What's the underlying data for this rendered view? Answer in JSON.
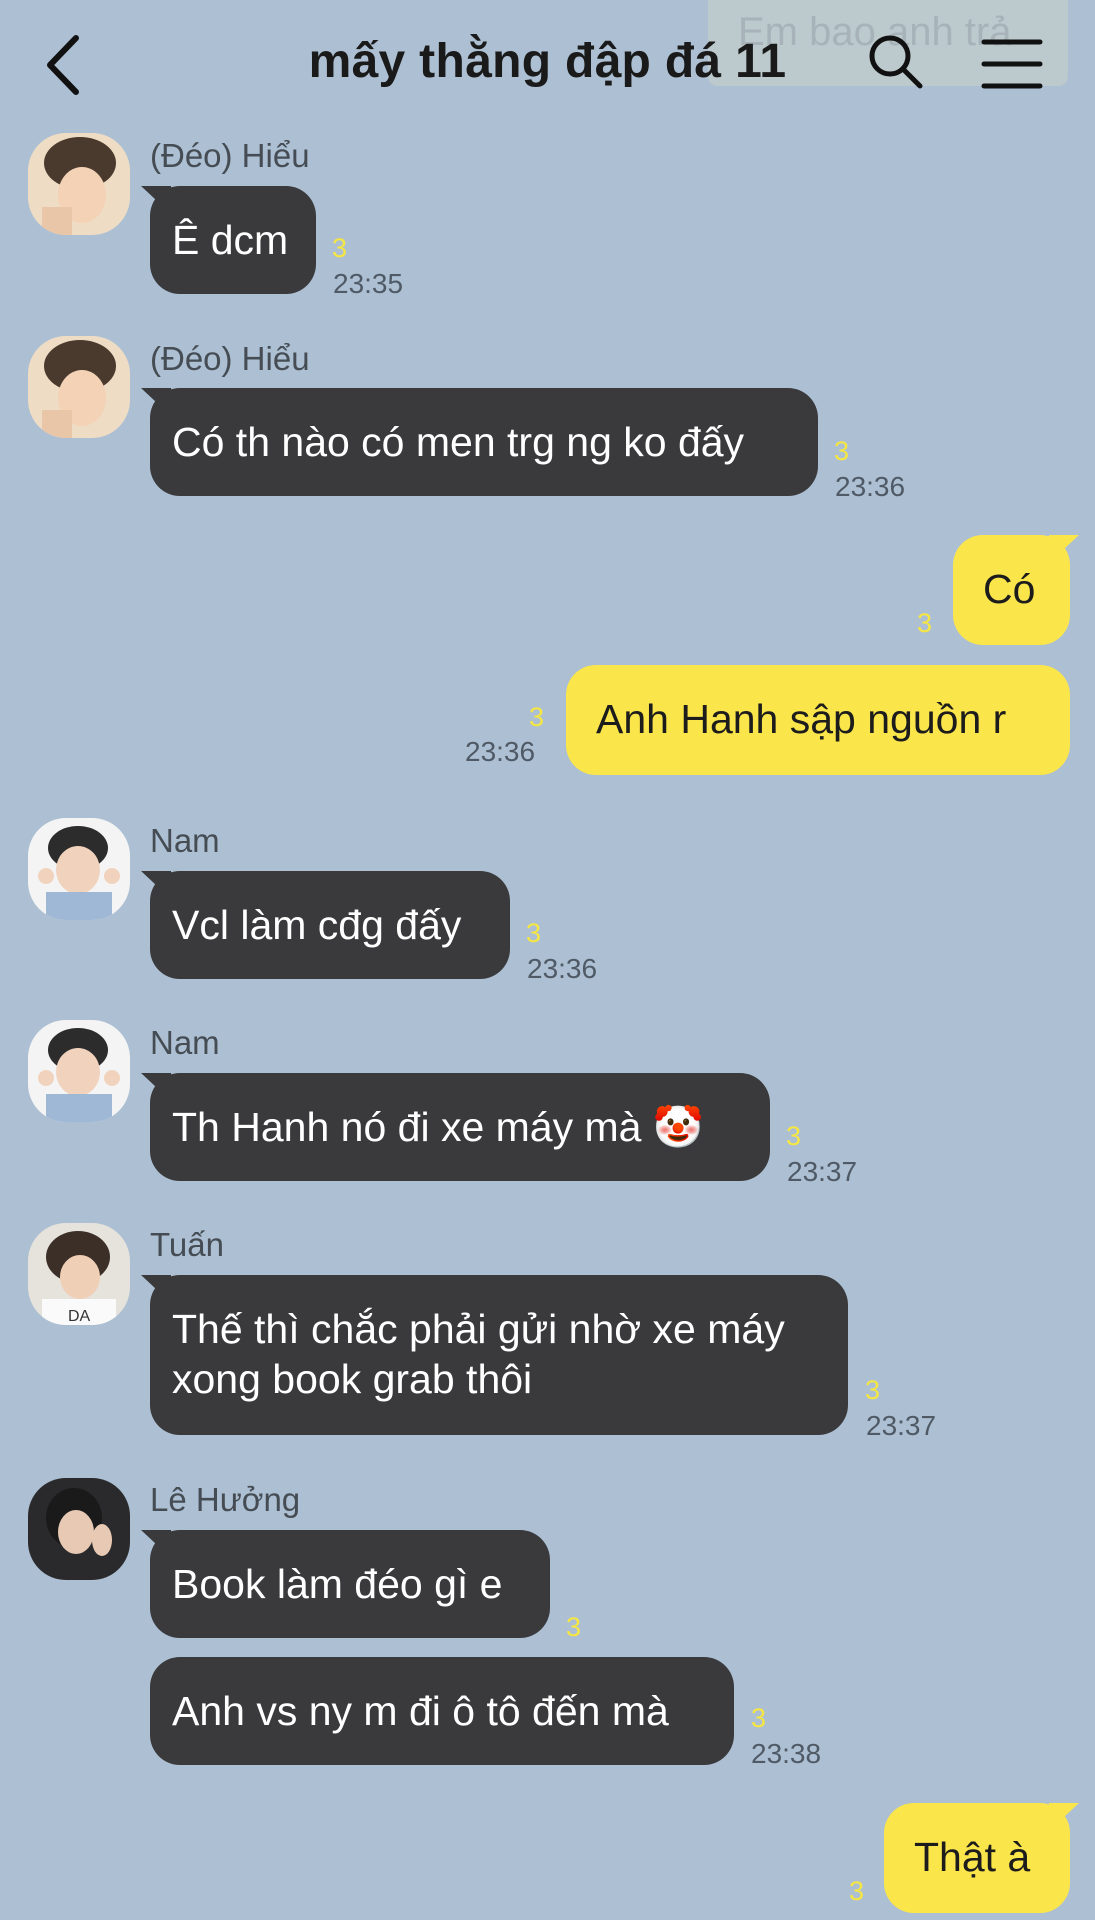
{
  "header": {
    "title": "mấy thằng đập đá 11",
    "pinned_preview": "Em bao anh trả"
  },
  "messages": [
    {
      "sender": "(Đéo) Hiểu",
      "text": "Ê dcm",
      "unread": "3",
      "time": "23:35"
    },
    {
      "sender": "(Đéo) Hiểu",
      "text": "Có th nào có men trg ng ko đấy",
      "unread": "3",
      "time": "23:36"
    },
    {
      "text": "Có",
      "unread": "3"
    },
    {
      "text": "Anh Hanh sập nguồn r",
      "unread": "3",
      "time": "23:36"
    },
    {
      "sender": "Nam",
      "text": "Vcl làm cđg đấy",
      "unread": "3",
      "time": "23:36"
    },
    {
      "sender": "Nam",
      "text": "Th Hanh nó đi xe máy mà 🤡",
      "unread": "3",
      "time": "23:37"
    },
    {
      "sender": "Tuấn",
      "text_line1": "Thế thì chắc phải gửi nhờ xe máy",
      "text_line2": "xong book grab thôi",
      "unread": "3",
      "time": "23:37"
    },
    {
      "sender": "Lê Hưởng",
      "text": "Book làm đéo gì e",
      "unread": "3"
    },
    {
      "text": "Anh vs ny m đi ô tô đến mà",
      "unread": "3",
      "time": "23:38"
    },
    {
      "text": "Thật à",
      "unread": "3"
    }
  ],
  "colors": {
    "background": "#adc0d3",
    "incoming_bubble": "#3a3a3c",
    "outgoing_bubble": "#fae54a",
    "unread_count": "#f5e642"
  },
  "icons": {
    "back": "chevron-left-icon",
    "search": "search-icon",
    "menu": "hamburger-menu-icon",
    "reaction": "clown-face-emoji"
  }
}
